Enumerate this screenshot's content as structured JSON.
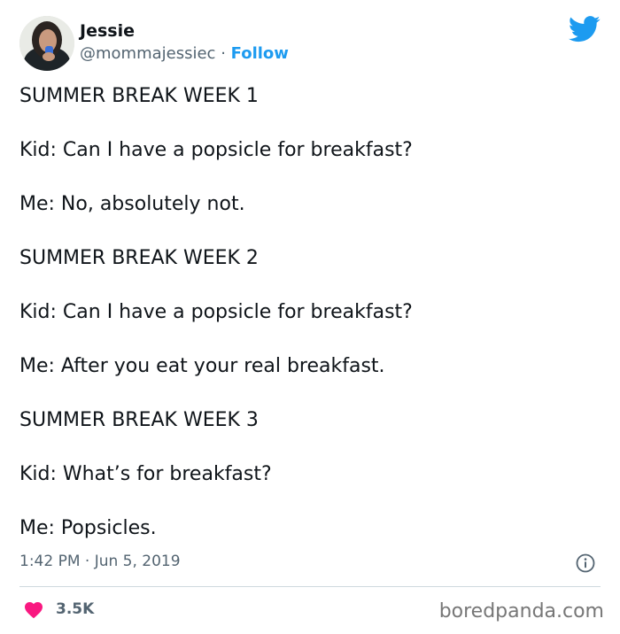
{
  "author": {
    "name": "Jessie",
    "handle": "@mommajessiec",
    "separator": "·",
    "follow_label": "Follow"
  },
  "tweet": {
    "lines": [
      "SUMMER BREAK WEEK 1",
      "Kid: Can I have a popsicle for breakfast?",
      "Me: No, absolutely not.",
      "SUMMER BREAK WEEK 2",
      "Kid: Can I have a popsicle for breakfast?",
      "Me: After you eat your real breakfast.",
      "SUMMER BREAK WEEK 3",
      "Kid: What’s for breakfast?",
      "Me: Popsicles."
    ],
    "timestamp": "1:42 PM · Jun 5, 2019",
    "likes": "3.5K"
  },
  "watermark": "boredpanda.com",
  "colors": {
    "accent": "#1d9bf0",
    "like": "#f91880",
    "secondary_text": "#536471"
  },
  "icons": {
    "brand": "twitter-bird-icon",
    "info": "info-icon",
    "like": "heart-icon"
  }
}
